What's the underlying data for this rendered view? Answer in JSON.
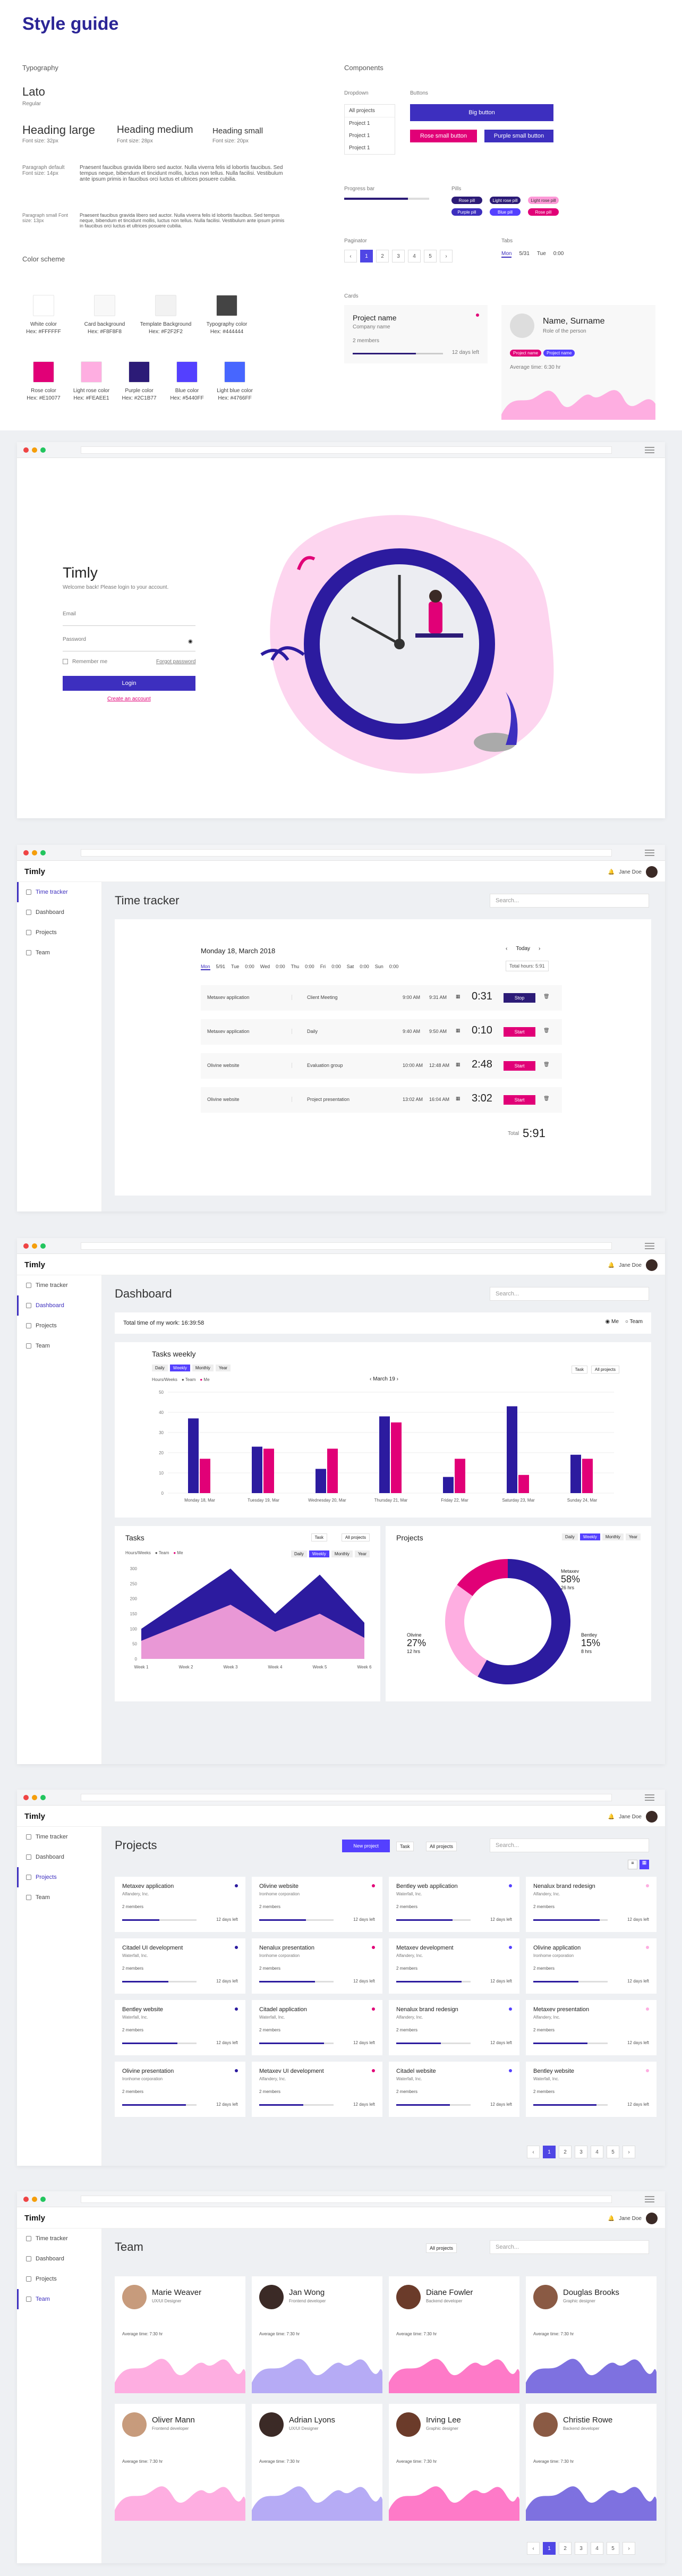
{
  "styleguide": {
    "title": "Style guide",
    "typography_label": "Typography",
    "font_name": "Lato",
    "font_style": "Regular",
    "headings": [
      {
        "t": "Heading large",
        "s": "Font size: 32px"
      },
      {
        "t": "Heading medium",
        "s": "Font size: 28px"
      },
      {
        "t": "Heading small",
        "s": "Font size: 20px"
      }
    ],
    "para_default_label": "Paragraph default Font size: 14px",
    "para_small_label": "Paragraph small Font size: 13px",
    "para_text": "Praesent faucibus gravida libero sed auctor. Nulla viverra felis id lobortis faucibus. Sed tempus neque, bibendum et tincidunt mollis, luctus non tellus. Nulla facilisi. Vestibulum ante ipsum primis in faucibus orci luctus et ultrices posuere cubilia.",
    "color_label": "Color scheme",
    "colors": [
      {
        "name": "White color",
        "hex": "Hex: #FFFFFF",
        "c": "#FFFFFF"
      },
      {
        "name": "Card background",
        "hex": "Hex: #F8F8F8",
        "c": "#F8F8F8"
      },
      {
        "name": "Template Background",
        "hex": "Hex: #F2F2F2",
        "c": "#F2F2F2"
      },
      {
        "name": "Typography color",
        "hex": "Hex: #444444",
        "c": "#444444"
      },
      {
        "name": "Rose color",
        "hex": "Hex: #E10077",
        "c": "#E10077"
      },
      {
        "name": "Light rose color",
        "hex": "Hex: #FEAEE1",
        "c": "#FEAEE1"
      },
      {
        "name": "Purple color",
        "hex": "Hex: #2C1B77",
        "c": "#2C1B77"
      },
      {
        "name": "Blue color",
        "hex": "Hex: #5440FF",
        "c": "#5440FF"
      },
      {
        "name": "Light blue color",
        "hex": "Hex: #4766FF",
        "c": "#4766FF"
      }
    ],
    "components_label": "Components",
    "dropdown_label": "Dropdown",
    "dropdown_value": "All projects",
    "dropdown_items": [
      "Project 1",
      "Project 1",
      "Project 1"
    ],
    "buttons_label": "Buttons",
    "btn_big": "Big button",
    "btn_rose": "Rose small button",
    "btn_purple": "Purple small button",
    "progress_label": "Progress bar",
    "pills_label": "Pills",
    "pills": [
      "Rose pill",
      "Light rose pill",
      "Purple pill",
      "Blue pill",
      "Light blue pill",
      "Dark pill"
    ],
    "paginator_label": "Paginator",
    "pages": [
      "1",
      "2",
      "3",
      "4",
      "5"
    ],
    "tabs_label": "Tabs",
    "tabs": [
      "Mon",
      "5/31",
      "Tue",
      "0:00"
    ],
    "cards_label": "Cards",
    "card_project": "Project name",
    "card_company": "Company name",
    "card_members": "2 members",
    "card_days": "12 days left",
    "card_person": "Name, Surname",
    "card_role": "Role of the person",
    "card_tag1": "Project name",
    "card_tag2": "Project name",
    "card_avg": "Average time: 6:30 hr"
  },
  "login": {
    "logo": "Timly",
    "welcome": "Welcome back! Please login to your account.",
    "email": "Email",
    "password": "Password",
    "remember": "Remember me",
    "forgot": "Forgot password",
    "login_btn": "Login",
    "create": "Create an account"
  },
  "app": {
    "logo": "Timly",
    "user": "Jane Doe",
    "search": "Search...",
    "nav": [
      "Time tracker",
      "Dashboard",
      "Projects",
      "Team"
    ]
  },
  "tracker": {
    "title": "Time tracker",
    "date": "Monday 18, March 2018",
    "today": "Today",
    "total_week": "Total hours: 5:91",
    "days": [
      "Mon",
      "5/91",
      "Tue",
      "0:00",
      "Wed",
      "0:00",
      "Thu",
      "0:00",
      "Fri",
      "0:00",
      "Sat",
      "0:00",
      "Sun",
      "0:00"
    ],
    "rows": [
      {
        "project": "Metaxev application",
        "task": "Client Meeting",
        "start": "9:00 AM",
        "end": "9:31 AM",
        "dur": "0:31",
        "btn": "Stop"
      },
      {
        "project": "Metaxev application",
        "task": "Daily",
        "start": "9:40 AM",
        "end": "9:50 AM",
        "dur": "0:10",
        "btn": "Start"
      },
      {
        "project": "Olivine website",
        "task": "Evaluation group",
        "start": "10:00 AM",
        "end": "12:48 AM",
        "dur": "2:48",
        "btn": "Start"
      },
      {
        "project": "Olivine website",
        "task": "Project presentation",
        "start": "13:02 AM",
        "end": "16:04 AM",
        "dur": "3:02",
        "btn": "Start"
      }
    ],
    "total_label": "Total",
    "total": "5:91"
  },
  "dashboard": {
    "title": "Dashboard",
    "total_time": "Total time of my work: 16:39:58",
    "me": "Me",
    "team": "Team",
    "weekly_title": "Tasks weekly",
    "period": [
      "Daily",
      "Weekly",
      "Monthly",
      "Year"
    ],
    "week_label": "March 19",
    "legend": [
      "Hours/Weeks",
      "Team",
      "Me"
    ],
    "tasks_title": "Tasks",
    "projects_title": "Projects",
    "filter_all": "All projects",
    "filter_task": "Task",
    "donut": [
      {
        "name": "Metaxev",
        "pct": "58%",
        "hrs": "26 hrs"
      },
      {
        "name": "Olivine",
        "pct": "27%",
        "hrs": "12 hrs"
      },
      {
        "name": "Bentley",
        "pct": "15%",
        "hrs": "8 hrs"
      }
    ]
  },
  "chart_data": [
    {
      "type": "bar",
      "title": "Tasks weekly",
      "categories": [
        "Monday 18, Mar",
        "Tuesday 19, Mar",
        "Wednesday 20, Mar",
        "Thursday 21, Mar",
        "Friday 22, Mar",
        "Saturday 23, Mar",
        "Sunday 24, Mar"
      ],
      "series": [
        {
          "name": "Team",
          "values": [
            37,
            23,
            12,
            38,
            8,
            43,
            19
          ]
        },
        {
          "name": "Me",
          "values": [
            17,
            22,
            22,
            35,
            17,
            9,
            17
          ]
        }
      ],
      "ylim": [
        0,
        50
      ]
    },
    {
      "type": "area",
      "title": "Tasks",
      "categories": [
        "Week 1",
        "Week 2",
        "Week 3",
        "Week 4",
        "Week 5",
        "Week 6"
      ],
      "series": [
        {
          "name": "Team",
          "values": [
            100,
            200,
            300,
            150,
            280,
            120
          ]
        },
        {
          "name": "Me",
          "values": [
            60,
            120,
            180,
            90,
            150,
            70
          ]
        }
      ],
      "ylim": [
        0,
        300
      ]
    },
    {
      "type": "pie",
      "title": "Projects",
      "categories": [
        "Metaxev",
        "Olivine",
        "Bentley"
      ],
      "values": [
        58,
        27,
        15
      ]
    }
  ],
  "projects": {
    "title": "Projects",
    "new_btn": "New project",
    "filter": "All projects",
    "task": "Task",
    "cards": [
      {
        "name": "Metaxev application",
        "co": "Alfandery, Inc."
      },
      {
        "name": "Olivine website",
        "co": "Ironhome corporation"
      },
      {
        "name": "Bentley web application",
        "co": "Waterfall, Inc."
      },
      {
        "name": "Nenalux brand redesign",
        "co": "Alfandery, Inc."
      },
      {
        "name": "Citadel UI development",
        "co": "Waterfall, Inc."
      },
      {
        "name": "Nenalux presentation",
        "co": "Ironhome corporation"
      },
      {
        "name": "Metaxev development",
        "co": "Alfandery, Inc."
      },
      {
        "name": "Olivine application",
        "co": "Ironhome corporation"
      },
      {
        "name": "Bentley website",
        "co": "Waterfall, Inc."
      },
      {
        "name": "Citadel application",
        "co": "Waterfall, Inc."
      },
      {
        "name": "Nenalux brand redesign",
        "co": "Alfandery, Inc."
      },
      {
        "name": "Metaxev presentation",
        "co": "Alfandery, Inc."
      },
      {
        "name": "Olivine presentation",
        "co": "Ironhome corporation"
      },
      {
        "name": "Metaxev UI development",
        "co": "Alfandery, Inc."
      },
      {
        "name": "Citadel website",
        "co": "Waterfall, Inc."
      },
      {
        "name": "Bentley website",
        "co": "Waterfall, Inc."
      }
    ],
    "members": "2 members",
    "days": "12 days left"
  },
  "team": {
    "title": "Team",
    "filter": "All projects",
    "avg": "Average time: 7:30 hr",
    "people": [
      {
        "n": "Marie Weaver",
        "r": "UX/UI Designer"
      },
      {
        "n": "Jan Wong",
        "r": "Frontend developer"
      },
      {
        "n": "Diane Fowler",
        "r": "Backend developer"
      },
      {
        "n": "Douglas Brooks",
        "r": "Graphic designer"
      },
      {
        "n": "Oliver Mann",
        "r": "Frontend developer"
      },
      {
        "n": "Adrian Lyons",
        "r": "UX/UI Designer"
      },
      {
        "n": "Irving Lee",
        "r": "Graphic designer"
      },
      {
        "n": "Christie Rowe",
        "r": "Backend developer"
      }
    ]
  },
  "pager": [
    "‹",
    "1",
    "2",
    "3",
    "4",
    "5",
    "›"
  ]
}
